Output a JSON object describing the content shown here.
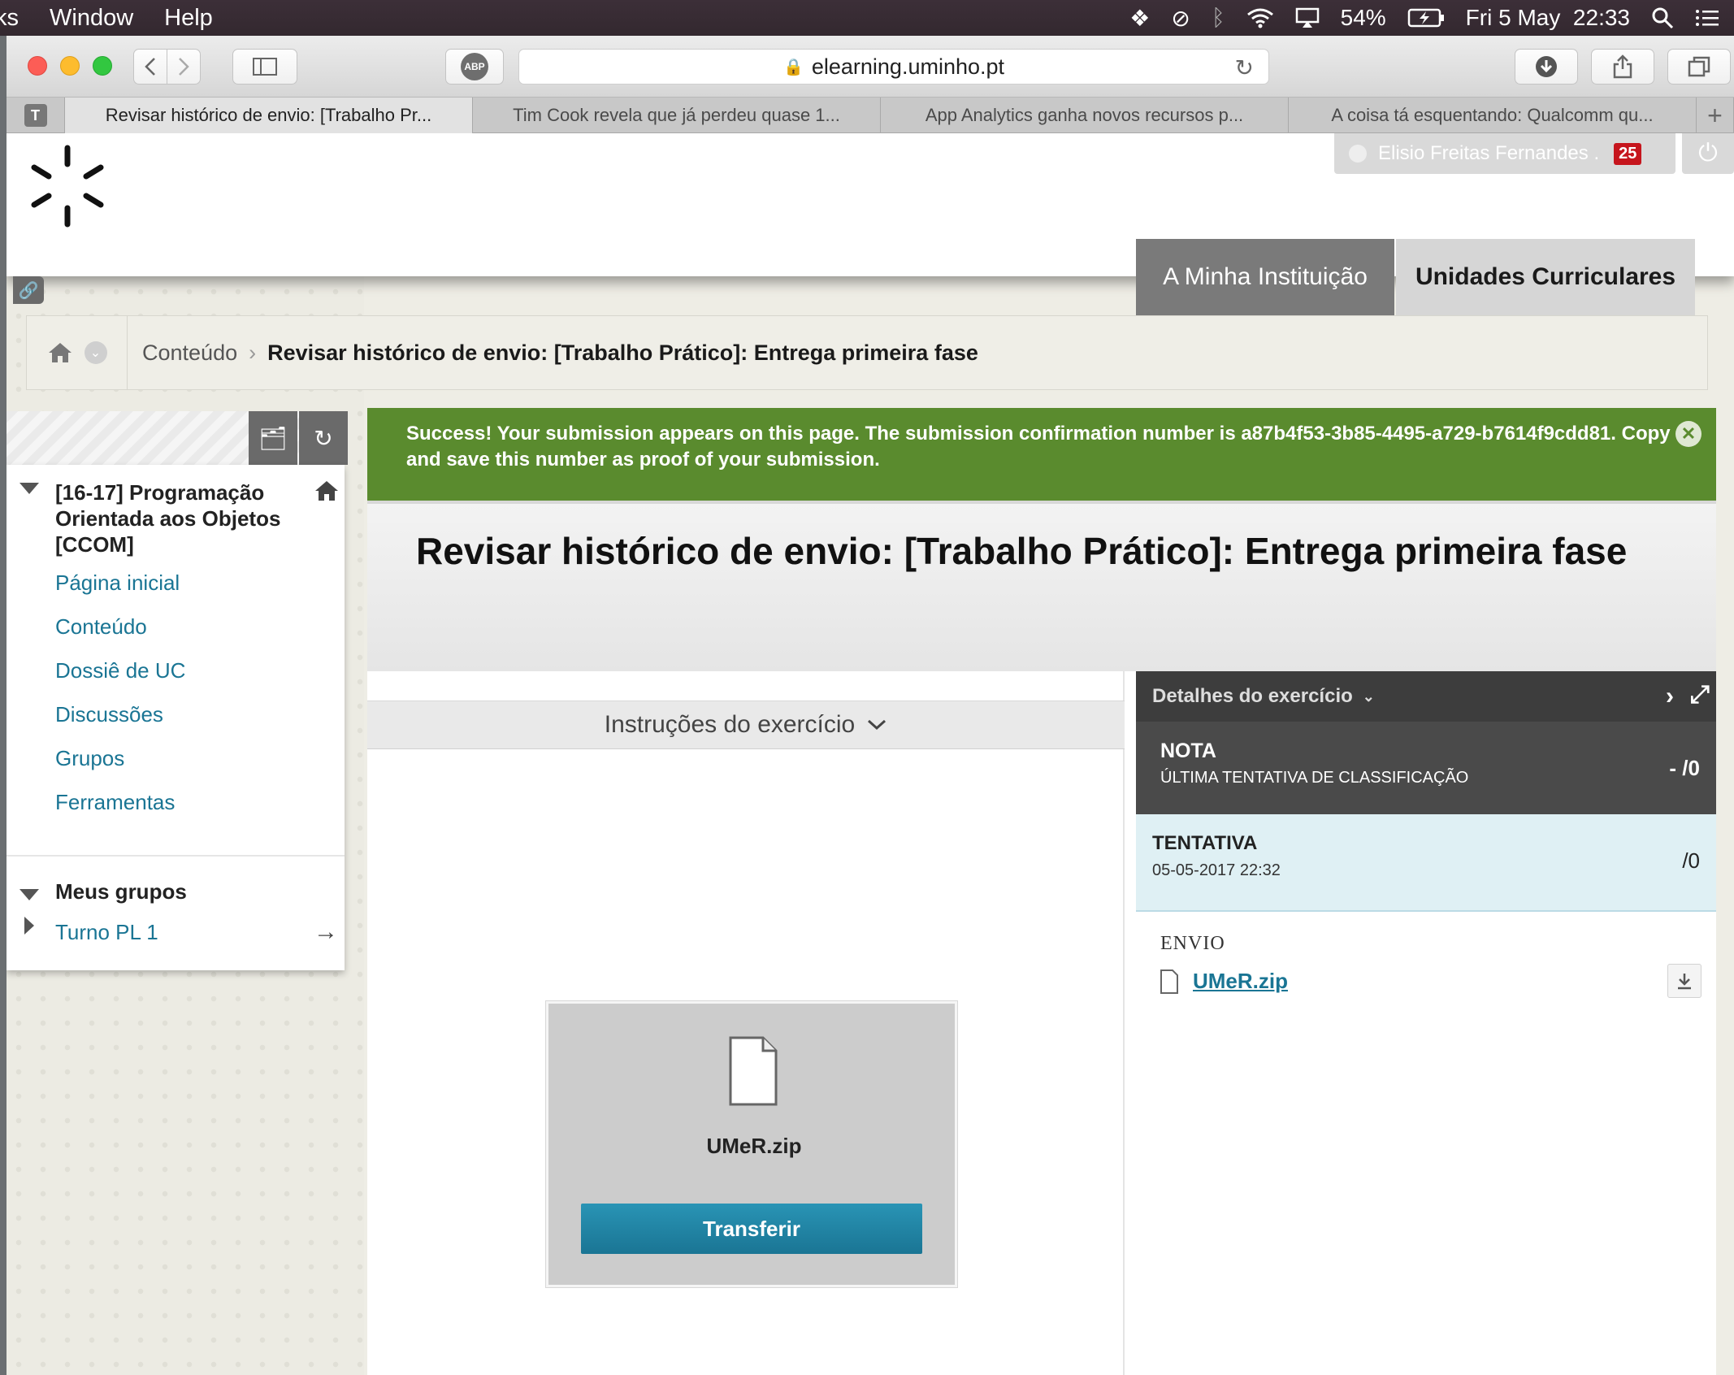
{
  "menubar": {
    "items": [
      "ks",
      "Window",
      "Help"
    ],
    "battery": "54%",
    "date": "Fri 5 May",
    "time": "22:33"
  },
  "browser": {
    "url": "elearning.uminho.pt",
    "abp_label": "ABP",
    "tab_badge": "T",
    "tabs": [
      "Revisar histórico de envio: [Trabalho Pr...",
      "Tim Cook revela que já perdeu quase 1...",
      "App Analytics ganha novos recursos p...",
      "A coisa tá esquentando: Qualcomm qu..."
    ]
  },
  "header": {
    "user_name": "Elisio Freitas Fernandes .",
    "notification_count": "25",
    "nav_institution": "A Minha Instituição",
    "nav_courses": "Unidades Curriculares"
  },
  "breadcrumb": {
    "parent": "Conteúdo",
    "current": "Revisar histórico de envio: [Trabalho Prático]: Entrega primeira fase"
  },
  "course_menu": {
    "title": "[16-17] Programação Orientada aos Objetos [CCOM]",
    "links": [
      "Página inicial",
      "Conteúdo",
      "Dossiê de UC",
      "Discussões",
      "Grupos",
      "Ferramentas"
    ],
    "groups_heading": "Meus grupos",
    "group_item": "Turno PL 1"
  },
  "banner": {
    "message": "Success! Your submission appears on this page. The submission confirmation number is a87b4f53-3b85-4495-a729-b7614f9cdd81. Copy and save this number as proof of your submission."
  },
  "main": {
    "title": "Revisar histórico de envio: [Trabalho Prático]: Entrega primeira fase",
    "instructions_label": "Instruções do exercício",
    "file_name": "UMeR.zip",
    "download_label": "Transferir"
  },
  "details": {
    "heading": "Detalhes do exercício",
    "grade_label": "NOTA",
    "grade_sub": "ÚLTIMA TENTATIVA DE CLASSIFICAÇÃO",
    "grade_value": "- /0",
    "attempt_label": "TENTATIVA",
    "attempt_date": "05-05-2017 22:32",
    "attempt_value": "/0",
    "submission_label": "ENVIO",
    "submission_file": "UMeR.zip"
  },
  "colors": {
    "success_green": "#5a8b2e",
    "link_teal": "#1a7594",
    "button_blue": "#1a7594",
    "badge_red": "#c6151d"
  }
}
